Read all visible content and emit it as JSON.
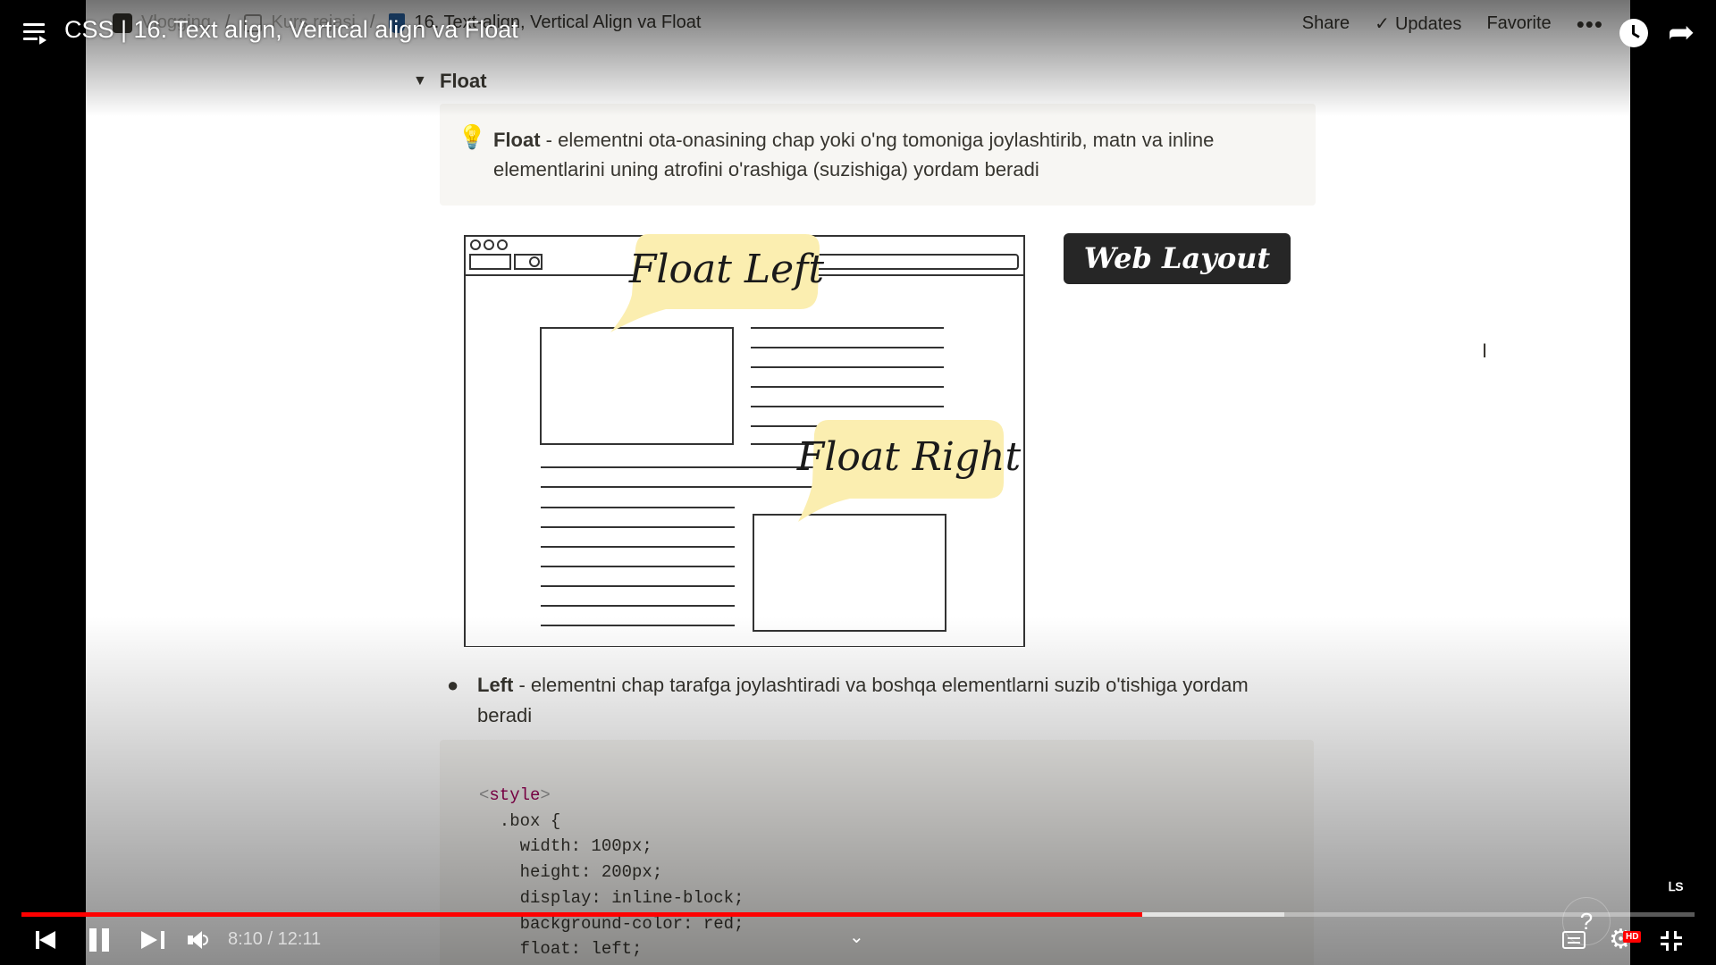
{
  "player": {
    "title": "CSS | 16. Text align, Vertical align va Float",
    "time_current": "8:10",
    "time_total": "12:11",
    "time_display": "8:10 / 12:11",
    "progress_fraction": 0.67,
    "buffer_fraction": 0.755,
    "quality_badge": "HD",
    "help_label": "?",
    "watermark": "ꓡS"
  },
  "notion": {
    "breadcrumbs": [
      {
        "label": "Vlogging"
      },
      {
        "label": "Kurs rejasi"
      },
      {
        "label": "16. Text-align, Vertical Align va Float"
      }
    ],
    "separator": "/",
    "topbar": {
      "share": "Share",
      "updates": "Updates",
      "favorite": "Favorite",
      "more": "•••"
    },
    "toggle_label": "Float",
    "callout": {
      "icon": "💡",
      "bold": "Float",
      "text": " - elementni ota-onasining chap yoki o'ng tomoniga joylashtirib, matn va inline elementlarini uning atrofini o'rashiga (suzishiga) yordam beradi"
    },
    "illustration": {
      "float_left": "Float Left",
      "float_right": "Float Right",
      "web_layout": "Web Layout"
    },
    "bullet": {
      "bold": "Left",
      "text": " - elementni chap tarafga joylashtiradi va boshqa elementlarni suzib o'tishiga yordam beradi"
    },
    "code": {
      "open_tag_lt": "<",
      "tag_name": "style",
      "open_tag_gt": ">",
      "lines": [
        "  .box {",
        "    width: 100px;",
        "    height: 200px;",
        "    display: inline-block;",
        "    background-color: red;",
        "    float: left;"
      ]
    }
  },
  "colors": {
    "progress_played": "#ff0000",
    "notion_text": "#37352f",
    "callout_bg": "#f7f6f3",
    "bubble": "#fbeeb0",
    "css_tag": "#990055"
  }
}
